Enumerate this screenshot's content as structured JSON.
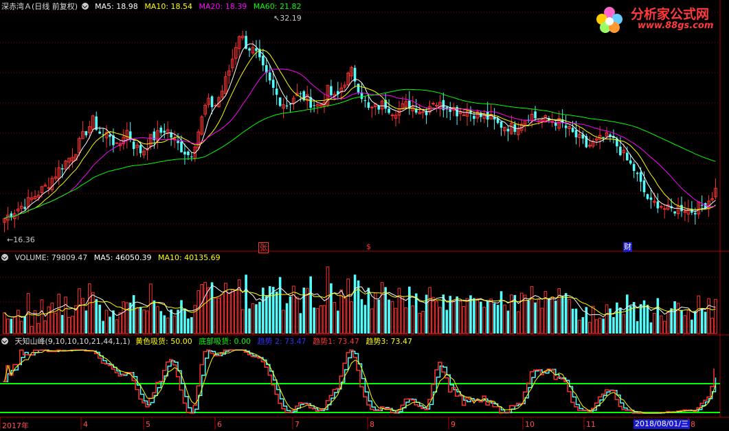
{
  "main_header": {
    "title": "深赤湾Ａ(日线 前复权)",
    "ma5": "MA5: 18.98",
    "ma10": "MA10: 18.54",
    "ma20": "MA20: 18.39",
    "ma60": "MA60: 21.82"
  },
  "price_labels": {
    "high": "32.19",
    "low": "16.36"
  },
  "flags": {
    "zhang": "张",
    "dollar": "$",
    "cai": "财"
  },
  "volume_header": {
    "volume": "VOLUME: 79809.47",
    "ma5": "MA5: 46050.39",
    "ma10": "MA10: 40135.69"
  },
  "indicator_header": {
    "name": "天知山峰(9,10,10,10,21,44,1,1)",
    "huangse": "黄色吸货: 50.00",
    "dibu": "底部吸货: 0.00",
    "qushi2": "趋势 2: 73.47",
    "qushi1": "趋势1: 73.47",
    "qushi3": "趋势3: 73.47"
  },
  "time_axis": [
    "2017年",
    "4",
    "5",
    "6",
    "7",
    "8",
    "9",
    "10",
    "11",
    "8"
  ],
  "cursor_date": "2018/08/01/三",
  "logo": {
    "text": "分析家公式网",
    "url": "www.88gs.com"
  },
  "colors": {
    "up": "#ff3232",
    "down": "#54fcfc",
    "ma5": "#ffffff",
    "ma10": "#ffff00",
    "ma20": "#ff00ff",
    "ma60": "#00ff00",
    "grid": "#8b0000"
  },
  "chart_data": [
    {
      "type": "candlestick",
      "title": "深赤湾Ａ(日线 前复权)",
      "series_summary": {
        "high": 32.19,
        "low": 16.36
      },
      "ma_values": {
        "MA5": 18.98,
        "MA10": 18.54,
        "MA20": 18.39,
        "MA60": 21.82
      },
      "close_path": [
        17.0,
        17.5,
        17.9,
        18.3,
        18.9,
        19.4,
        20.2,
        21.0,
        21.7,
        22.5,
        23.7,
        24.6,
        23.4,
        23.6,
        22.3,
        24.0,
        22.7,
        22.1,
        23.1,
        23.5,
        24.0,
        23.0,
        22.4,
        21.8,
        23.8,
        26.0,
        25.7,
        27.0,
        28.9,
        31.4,
        30.4,
        29.9,
        28.5,
        27.3,
        26.2,
        25.8,
        26.6,
        26.4,
        26.0,
        25.7,
        26.9,
        26.2,
        27.6,
        28.4,
        26.9,
        25.4,
        25.6,
        25.9,
        25.4,
        25.5,
        25.9,
        25.6,
        25.2,
        26.2,
        25.7,
        25.8,
        25.3,
        25.4,
        25.2,
        24.9,
        24.8,
        24.3,
        24.2,
        24.0,
        24.6,
        25.1,
        24.7,
        24.6,
        24.6,
        24.3,
        23.7,
        23.2,
        22.6,
        22.8,
        23.2,
        23.2,
        22.5,
        21.5,
        20.7,
        19.2,
        18.1,
        18.2,
        17.6,
        17.7,
        17.9,
        17.6,
        17.9,
        18.3,
        19.2
      ]
    },
    {
      "type": "bar",
      "title": "VOLUME",
      "values": {
        "VOLUME": 79809.47,
        "MA5": 46050.39,
        "MA10": 40135.69
      }
    },
    {
      "type": "line",
      "title": "天知山峰(9,10,10,10,21,44,1,1)",
      "values": {
        "黄色吸货": 50.0,
        "底部吸货": 0.0,
        "趋势2": 73.47,
        "趋势1": 73.47,
        "趋势3": 73.47
      }
    }
  ]
}
